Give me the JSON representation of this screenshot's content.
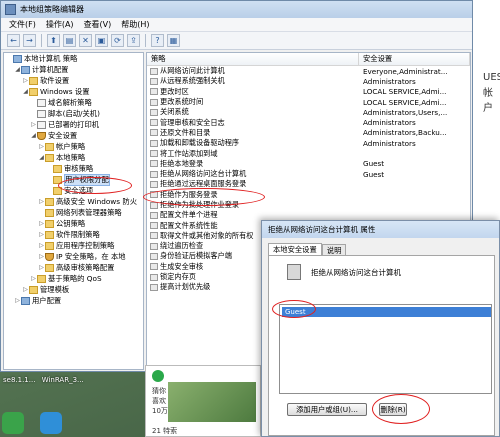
{
  "window": {
    "title": "本地组策略编辑器"
  },
  "menu": [
    "文件(F)",
    "操作(A)",
    "查看(V)",
    "帮助(H)"
  ],
  "toolbar_icons": [
    "back-icon",
    "forward-icon",
    "up-icon",
    "show-tree-icon",
    "delete-icon",
    "properties-icon",
    "refresh-icon",
    "export-icon",
    "help-icon",
    "view-icon"
  ],
  "tree": [
    {
      "label": "本地计算机 策略",
      "indent": 0,
      "icon": "computer",
      "exp": ""
    },
    {
      "label": "计算机配置",
      "indent": 1,
      "icon": "comp",
      "exp": "◢"
    },
    {
      "label": "软件设置",
      "indent": 2,
      "icon": "folder",
      "exp": "▷"
    },
    {
      "label": "Windows 设置",
      "indent": 2,
      "icon": "folder",
      "exp": "◢"
    },
    {
      "label": "域名解析策略",
      "indent": 3,
      "icon": "doc",
      "exp": ""
    },
    {
      "label": "脚本(启动/关机)",
      "indent": 3,
      "icon": "doc",
      "exp": ""
    },
    {
      "label": "已部署的打印机",
      "indent": 3,
      "icon": "doc",
      "exp": "▷"
    },
    {
      "label": "安全设置",
      "indent": 3,
      "icon": "shield",
      "exp": "◢"
    },
    {
      "label": "帐户策略",
      "indent": 4,
      "icon": "folder",
      "exp": "▷"
    },
    {
      "label": "本地策略",
      "indent": 4,
      "icon": "folder",
      "exp": "◢"
    },
    {
      "label": "审核策略",
      "indent": 5,
      "icon": "folder",
      "exp": ""
    },
    {
      "label": "用户权限分配",
      "indent": 5,
      "icon": "folder",
      "exp": "",
      "selected": true
    },
    {
      "label": "安全选项",
      "indent": 5,
      "icon": "folder",
      "exp": ""
    },
    {
      "label": "高级安全 Windows 防火",
      "indent": 4,
      "icon": "folder",
      "exp": "▷"
    },
    {
      "label": "网络列表管理器策略",
      "indent": 4,
      "icon": "folder",
      "exp": ""
    },
    {
      "label": "公钥策略",
      "indent": 4,
      "icon": "folder",
      "exp": "▷"
    },
    {
      "label": "软件限制策略",
      "indent": 4,
      "icon": "folder",
      "exp": "▷"
    },
    {
      "label": "应用程序控制策略",
      "indent": 4,
      "icon": "folder",
      "exp": "▷"
    },
    {
      "label": "IP 安全策略，在 本地",
      "indent": 4,
      "icon": "shield",
      "exp": "▷"
    },
    {
      "label": "高级审核策略配置",
      "indent": 4,
      "icon": "folder",
      "exp": "▷"
    },
    {
      "label": "基于策略的 QoS",
      "indent": 3,
      "icon": "folder",
      "exp": "▷"
    },
    {
      "label": "管理模板",
      "indent": 2,
      "icon": "folder",
      "exp": "▷"
    },
    {
      "label": "用户配置",
      "indent": 1,
      "icon": "comp",
      "exp": "▷"
    }
  ],
  "list_header": {
    "policy": "策略",
    "setting": "安全设置"
  },
  "list_rows": [
    {
      "policy": "从网络访问此计算机",
      "setting": "Everyone,Administrat..."
    },
    {
      "policy": "从远程系统强制关机",
      "setting": "Administrators"
    },
    {
      "policy": "更改时区",
      "setting": "LOCAL SERVICE,Admi..."
    },
    {
      "policy": "更改系统时间",
      "setting": "LOCAL SERVICE,Admi..."
    },
    {
      "policy": "关闭系统",
      "setting": "Administrators,Users,..."
    },
    {
      "policy": "管理审核和安全日志",
      "setting": "Administrators"
    },
    {
      "policy": "还原文件和目录",
      "setting": "Administrators,Backu..."
    },
    {
      "policy": "加载和卸载设备驱动程序",
      "setting": "Administrators"
    },
    {
      "policy": "将工作站添加到域",
      "setting": ""
    },
    {
      "policy": "拒绝本地登录",
      "setting": "Guest"
    },
    {
      "policy": "拒绝从网络访问这台计算机",
      "setting": "Guest",
      "highlight": true
    },
    {
      "policy": "拒绝通过远程桌面服务登录",
      "setting": ""
    },
    {
      "policy": "拒绝作为服务登录",
      "setting": ""
    },
    {
      "policy": "拒绝作为批处理作业登录",
      "setting": ""
    },
    {
      "policy": "配置文件单个进程",
      "setting": ""
    },
    {
      "policy": "配置文件系统性能",
      "setting": ""
    },
    {
      "policy": "取得文件或其他对象的所有权",
      "setting": ""
    },
    {
      "policy": "绕过遍历检查",
      "setting": ""
    },
    {
      "policy": "身份验证后模拟客户端",
      "setting": ""
    },
    {
      "policy": "生成安全审核",
      "setting": ""
    },
    {
      "policy": "锁定内存页",
      "setting": ""
    },
    {
      "policy": "提高计划优先级",
      "setting": ""
    }
  ],
  "dialog": {
    "title": "拒绝从网络访问这台计算机 属性",
    "tab_local": "本地安全设置",
    "tab_explain": "说明",
    "policy_name": "拒绝从网络访问这台计算机",
    "users": [
      "Guest"
    ],
    "add_button": "添加用户或组(U)...",
    "remove_button": "删除(R)"
  },
  "right_strip": {
    "text1": "UEST",
    "text2": "帐户"
  },
  "taskbar": {
    "item1": "se8.1.1...",
    "item2": "WinRAR_3...",
    "card_line1": "猜你",
    "card_line2": "喜欢",
    "card_line3": "10万+",
    "card_footer": "21 特索"
  },
  "colors": {
    "selection": "#3d7fd6",
    "annotation": "#e02020",
    "titlebar": "#c2d6ee"
  }
}
